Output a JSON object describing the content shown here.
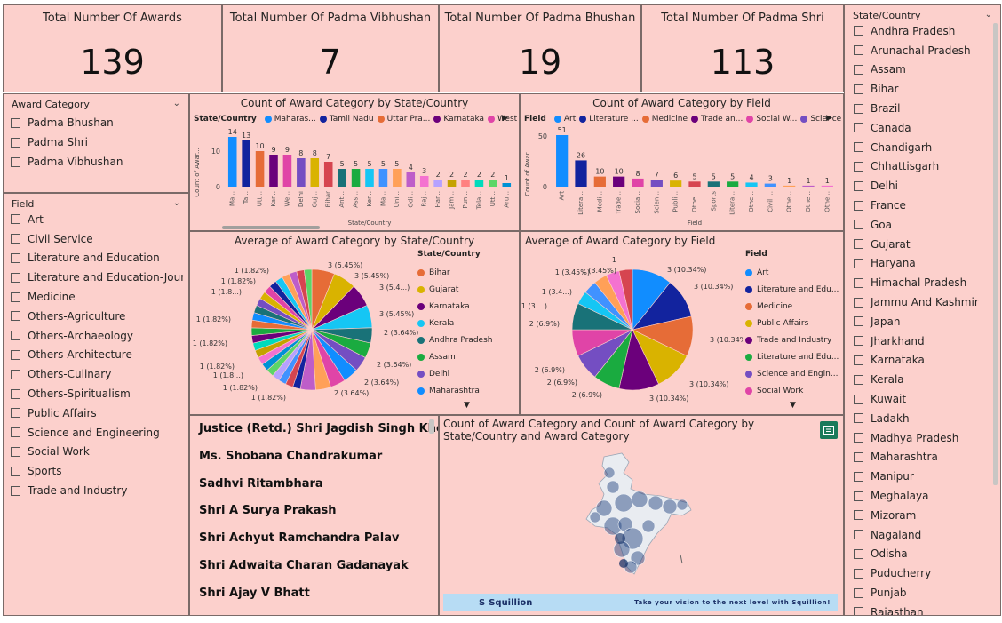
{
  "kpis": [
    {
      "title": "Total Number Of Awards",
      "value": "139"
    },
    {
      "title": "Total Number Of Padma Vibhushan",
      "value": "7"
    },
    {
      "title": "Total Number Of Padma Bhushan",
      "value": "19"
    },
    {
      "title": "Total Number Of Padma Shri",
      "value": "113"
    }
  ],
  "award_slicer": {
    "title": "Award Category",
    "items": [
      "Padma Bhushan",
      "Padma Shri",
      "Padma Vibhushan"
    ]
  },
  "field_slicer": {
    "title": "Field",
    "items": [
      "Art",
      "Civil Service",
      "Literature and Education",
      "Literature and Education-Journ...",
      "Medicine",
      "Others-Agriculture",
      "Others-Archaeology",
      "Others-Architecture",
      "Others-Culinary",
      "Others-Spiritualism",
      "Public Affairs",
      "Science and Engineering",
      "Social Work",
      "Sports",
      "Trade and Industry"
    ]
  },
  "state_slicer": {
    "title": "State/Country",
    "items": [
      "Andhra Pradesh",
      "Arunachal Pradesh",
      "Assam",
      "Bihar",
      "Brazil",
      "Canada",
      "Chandigarh",
      "Chhattisgarh",
      "Delhi",
      "France",
      "Goa",
      "Gujarat",
      "Haryana",
      "Himachal Pradesh",
      "Jammu And Kashmir",
      "Japan",
      "Jharkhand",
      "Karnataka",
      "Kerala",
      "Kuwait",
      "Ladakh",
      "Madhya Pradesh",
      "Maharashtra",
      "Manipur",
      "Meghalaya",
      "Mizoram",
      "Nagaland",
      "Odisha",
      "Puducherry",
      "Punjab",
      "Rajasthan"
    ]
  },
  "bar_state": {
    "title": "Count of Award Category by State/Country",
    "legend_title": "State/Country",
    "legend_items": [
      {
        "label": "Maharas...",
        "color": "#118dff"
      },
      {
        "label": "Tamil Nadu",
        "color": "#12239e"
      },
      {
        "label": "Uttar Pra...",
        "color": "#e66c37"
      },
      {
        "label": "Karnataka",
        "color": "#6b007b"
      },
      {
        "label": "West Ben...",
        "color": "#e044a7"
      }
    ],
    "ylabel": "Count of Awar...",
    "xlabel": "State/Country",
    "yticks": [
      "0",
      "10"
    ]
  },
  "bar_field": {
    "title": "Count of Award Category by Field",
    "legend_title": "Field",
    "legend_items": [
      {
        "label": "Art",
        "color": "#118dff"
      },
      {
        "label": "Literature ...",
        "color": "#12239e"
      },
      {
        "label": "Medicine",
        "color": "#e66c37"
      },
      {
        "label": "Trade an...",
        "color": "#6b007b"
      },
      {
        "label": "Social W...",
        "color": "#e044a7"
      },
      {
        "label": "Science a...",
        "color": "#744ec2"
      }
    ],
    "ylabel": "Count of Awar...",
    "xlabel": "Field",
    "yticks": [
      "0",
      "50"
    ]
  },
  "pie_state": {
    "title": "Average of Award Category by State/Country",
    "legend_title": "State/Country",
    "legend_items": [
      {
        "label": "Bihar",
        "color": "#e66c37"
      },
      {
        "label": "Gujarat",
        "color": "#d9b300"
      },
      {
        "label": "Karnataka",
        "color": "#6b007b"
      },
      {
        "label": "Kerala",
        "color": "#15c6f4"
      },
      {
        "label": "Andhra Pradesh",
        "color": "#197278"
      },
      {
        "label": "Assam",
        "color": "#1aab40"
      },
      {
        "label": "Delhi",
        "color": "#744ec2"
      },
      {
        "label": "Maharashtra",
        "color": "#118dff"
      }
    ]
  },
  "pie_field": {
    "title": "Average of Award Category by Field",
    "legend_title": "Field",
    "legend_items": [
      {
        "label": "Art",
        "color": "#118dff"
      },
      {
        "label": "Literature and Edu...",
        "color": "#12239e"
      },
      {
        "label": "Medicine",
        "color": "#e66c37"
      },
      {
        "label": "Public Affairs",
        "color": "#d9b300"
      },
      {
        "label": "Trade and Industry",
        "color": "#6b007b"
      },
      {
        "label": "Literature and Edu...",
        "color": "#1aab40"
      },
      {
        "label": "Science and Engin...",
        "color": "#744ec2"
      },
      {
        "label": "Social Work",
        "color": "#e044a7"
      }
    ]
  },
  "names": [
    "Justice (Retd.) Shri Jagdish Singh Khehar",
    "Ms. Shobana Chandrakumar",
    "Sadhvi Ritambhara",
    "Shri A Surya Prakash",
    "Shri Achyut Ramchandra Palav",
    "Shri Adwaita Charan Gadanayak",
    "Shri Ajay V Bhatt"
  ],
  "map": {
    "title": "Count of Award Category and Count of Award Category by State/Country and Award Category",
    "banner_logo": "Squillion",
    "banner_tag": "Take your vision to the next level with Squillion!"
  },
  "chart_data": [
    {
      "type": "bar",
      "title": "Count of Award Category by State/Country",
      "xlabel": "State/Country",
      "ylabel": "Count of Awar...",
      "categories": [
        "Ma...",
        "Ta...",
        "Utt...",
        "Kar...",
        "We...",
        "Delhi",
        "Guj...",
        "Bihar",
        "Ant...",
        "Ass...",
        "Ker...",
        "Ma...",
        "Uni...",
        "Odi...",
        "Raj...",
        "Har...",
        "Jam...",
        "Pun...",
        "Tela...",
        "Utt...",
        "Aru..."
      ],
      "values": [
        14,
        13,
        10,
        9,
        9,
        8,
        8,
        7,
        5,
        5,
        5,
        5,
        5,
        4,
        3,
        2,
        2,
        2,
        2,
        2,
        1
      ],
      "colors": [
        "#118dff",
        "#12239e",
        "#e66c37",
        "#6b007b",
        "#e044a7",
        "#744ec2",
        "#d9b300",
        "#d64550",
        "#197278",
        "#1aab40",
        "#15c6f4",
        "#4092ff",
        "#ffa058",
        "#be5dc9",
        "#f472d0",
        "#b5a1ff",
        "#c4a200",
        "#ff8080",
        "#00dbbc",
        "#5bd667",
        "#0091d5"
      ]
    },
    {
      "type": "bar",
      "title": "Count of Award Category by Field",
      "xlabel": "Field",
      "ylabel": "Count of Awar...",
      "categories": [
        "Art",
        "Litera...",
        "Medi...",
        "Trade...",
        "Socia...",
        "Scien...",
        "Publi...",
        "Othe...",
        "Sports",
        "Litera...",
        "Othe...",
        "Civil ...",
        "Othe...",
        "Othe...",
        "Othe..."
      ],
      "values": [
        51,
        26,
        10,
        10,
        8,
        7,
        6,
        5,
        5,
        5,
        4,
        3,
        1,
        1,
        1
      ],
      "colors": [
        "#118dff",
        "#12239e",
        "#e66c37",
        "#6b007b",
        "#e044a7",
        "#744ec2",
        "#d9b300",
        "#d64550",
        "#197278",
        "#1aab40",
        "#15c6f4",
        "#4092ff",
        "#ffa058",
        "#be5dc9",
        "#f472d0"
      ]
    },
    {
      "type": "pie",
      "title": "Average of Award Category by State/Country",
      "slice_labels": [
        "3 (5.45%)",
        "3 (5.45%)",
        "3 (5.4...)",
        "3 (5.45%)",
        "2 (3.64%)",
        "2 (3.64%)",
        "2 (3.64%)",
        "2 (3.64%)",
        "1 (1.82%)",
        "1 (1.82%)",
        "1 (1.8...)",
        "1 (1.82%)",
        "1 (1.82%)",
        "1 (1.82%)",
        "1 (1.8...)",
        "1 (1.82%)",
        "1 (1.82%)"
      ],
      "values": [
        3,
        3,
        3,
        3,
        2,
        2,
        2,
        2,
        2,
        2,
        2,
        1,
        1,
        1,
        1,
        1,
        1,
        1,
        1,
        1,
        1,
        1,
        1,
        1,
        1,
        1,
        1,
        1,
        1,
        1,
        1,
        1,
        1,
        1
      ],
      "colors": [
        "#e66c37",
        "#d9b300",
        "#6b007b",
        "#15c6f4",
        "#197278",
        "#1aab40",
        "#744ec2",
        "#118dff",
        "#e044a7",
        "#ffa058",
        "#be5dc9",
        "#12239e",
        "#d64550",
        "#4092ff",
        "#b5a1ff",
        "#5bd667",
        "#0091d5",
        "#f472d0",
        "#c4a200",
        "#00dbbc",
        "#6b007b",
        "#1aab40",
        "#e66c37",
        "#118dff",
        "#197278",
        "#744ec2",
        "#d9b300",
        "#e044a7",
        "#12239e",
        "#15c6f4",
        "#ffa058",
        "#be5dc9",
        "#d64550",
        "#5bd667"
      ]
    },
    {
      "type": "pie",
      "title": "Average of Award Category by Field",
      "slice_labels": [
        "3 (10.34%)",
        "3 (10.34%)",
        "3 (10.34%)",
        "3 (10.34%)",
        "3 (10.34%)",
        "2 (6.9%)",
        "2 (6.9%)",
        "2 (6.9%)",
        "2 (6.9%)",
        "1 (3....)",
        "1 (3.4...)",
        "1 (3.45%)",
        "1 (3.45%)",
        "1"
      ],
      "values": [
        3,
        3,
        3,
        3,
        3,
        2,
        2,
        2,
        2,
        1,
        1,
        1,
        1,
        1
      ],
      "colors": [
        "#118dff",
        "#12239e",
        "#e66c37",
        "#d9b300",
        "#6b007b",
        "#1aab40",
        "#744ec2",
        "#e044a7",
        "#197278",
        "#15c6f4",
        "#4092ff",
        "#ffa058",
        "#f472d0",
        "#d64550"
      ]
    }
  ]
}
